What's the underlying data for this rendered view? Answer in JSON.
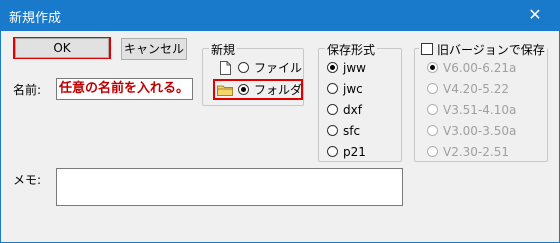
{
  "window": {
    "title": "新規作成",
    "close_glyph": "✕"
  },
  "buttons": {
    "ok": "OK",
    "cancel": "キャンセル"
  },
  "name": {
    "label": "名前:",
    "value": "任意の名前を入れる。"
  },
  "memo": {
    "label": "メモ:",
    "value": ""
  },
  "new_group": {
    "title": "新規",
    "options": [
      {
        "label": "ファイル",
        "icon": "file-icon",
        "selected": false
      },
      {
        "label": "フォルダ",
        "icon": "folder-icon",
        "selected": true
      }
    ]
  },
  "format_group": {
    "title": "保存形式",
    "options": [
      {
        "label": "jww",
        "selected": true
      },
      {
        "label": "jwc",
        "selected": false
      },
      {
        "label": "dxf",
        "selected": false
      },
      {
        "label": "sfc",
        "selected": false
      },
      {
        "label": "p21",
        "selected": false
      }
    ]
  },
  "old_version_group": {
    "checkbox_label": "旧バージョンで保存",
    "checked": false,
    "options": [
      {
        "label": "V6.00-6.21a",
        "selected": true
      },
      {
        "label": "V4.20-5.22",
        "selected": false
      },
      {
        "label": "V3.51-4.10a",
        "selected": false
      },
      {
        "label": "V3.00-3.50a",
        "selected": false
      },
      {
        "label": "V2.30-2.51",
        "selected": false
      }
    ]
  },
  "colors": {
    "titlebar": "#1979ca",
    "highlight": "#e00000",
    "name_text": "#c00000"
  }
}
